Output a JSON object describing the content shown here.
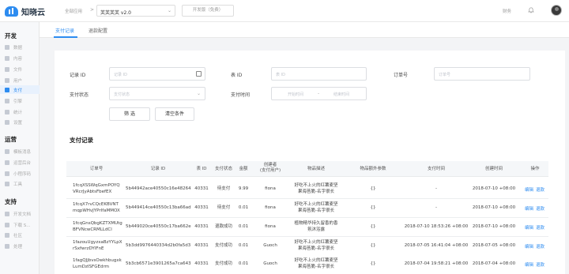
{
  "topbar": {
    "logo_text": "知晓云",
    "breadcrumb": "全部应用",
    "breadcrumb_sep": ">",
    "app_name": "芙芙芙芙 v2.0",
    "app_chevron": "⌄",
    "env_button": "开发版（免费）",
    "finance": "财务"
  },
  "sidebar": {
    "sections": [
      {
        "title": "开发",
        "items": [
          "数据",
          "内容",
          "文件",
          "用户",
          "支付",
          "引擎",
          "统计",
          "设置"
        ]
      },
      {
        "title": "运营",
        "items": [
          "模板消息",
          "运营后台",
          "小程序码",
          "工具"
        ]
      },
      {
        "title": "支持",
        "items": [
          "开发文档",
          "下载 S...",
          "社区",
          "处理"
        ]
      }
    ],
    "active_item": "支付"
  },
  "tabs": [
    "支付记录",
    "退款配置"
  ],
  "filters": {
    "record_id_label": "记录 ID",
    "record_id_placeholder": "记录 ID",
    "table_id_label": "表 ID",
    "table_id_placeholder": "表 ID",
    "order_no_label": "订单号",
    "order_no_placeholder": "订单号",
    "status_label": "支付状态",
    "status_placeholder": "支付状态",
    "time_label": "支付时间",
    "time_start": "开始时间",
    "time_sep": "-",
    "time_end": "结束时间",
    "filter_button": "筛 选",
    "clear_button": "清空条件"
  },
  "section_title": "支付记录",
  "table": {
    "headers": [
      "订单号",
      "记录 ID",
      "表 ID",
      "支付状态",
      "金额",
      "创建者\n(支付用户)",
      "物品描述",
      "物品额外参数",
      "支付时间",
      "创建时间",
      "操作"
    ],
    "rows": [
      {
        "order": [
          "1fcqXSSWqGxmPOYQ",
          "VRcrJyAbtsFbefEX"
        ],
        "record": "5b44942ace40550c16e48264",
        "table": "40331",
        "status": "待支付",
        "amount": "9.99",
        "creator": "fiona",
        "desc": [
          "好吃不上火的红薯麦坚",
          "果海苔脆-名字很长"
        ],
        "extra": "{}",
        "pay_time": "-",
        "create_time": "2018-07-10 +08:00",
        "ops": [
          "编辑",
          "退款"
        ]
      },
      {
        "order": [
          "1fcqX7rvCQcEKBVNT",
          "mqpWHvJYPrIfaMMOX"
        ],
        "record": "5b449414ce40550c13ba66ad",
        "table": "40331",
        "status": "待支付",
        "amount": "0.01",
        "creator": "fiona",
        "desc": [
          "好吃不上火的红薯麦坚",
          "果海苔脆-名字很长"
        ],
        "extra": "{}",
        "pay_time": "-",
        "create_time": "2018-07-10 +08:00",
        "ops": [
          "编辑",
          "退款"
        ]
      },
      {
        "order": [
          "1fcqGnsQbgKZTXMUtg",
          "BFVNcwCRMLLdCl"
        ],
        "record": "5b449020ce40550c17ba662e",
        "table": "40331",
        "status": "退款成功",
        "amount": "0.01",
        "creator": "fiona",
        "desc": [
          "植物精华持久留香的香",
          "氛沐浴露"
        ],
        "extra": "{}",
        "pay_time": "2018-07-10 18:53:26 +08:00",
        "create_time": "2018-07-10 +08:00",
        "ops": [
          "编辑",
          "退款"
        ]
      },
      {
        "order": [
          "1fazouUgyzxaBzYYLpX",
          "rSxfwrzDYIFnE"
        ],
        "record": "5b3dd9976440334d2b0fa5d3",
        "table": "40331",
        "status": "支付成功",
        "amount": "0.01",
        "creator": "Guoch",
        "desc": [
          "好吃不上火的红薯麦坚",
          "果海苔脆-名字很长"
        ],
        "extra": "{}",
        "pay_time": "2018-07-05 16:41:04 +08:00",
        "create_time": "2018-07-05 +08:00",
        "ops": [
          "编辑",
          "退款"
        ]
      },
      {
        "order": [
          "1fagQJjbvsOwkhbugxk",
          "LumDzISFGEdrm"
        ],
        "record": "5b3cb6571e3901265a7ca643",
        "table": "40331",
        "status": "支付成功",
        "amount": "0.01",
        "creator": "Guoch",
        "desc": [
          "好吃不上火的红薯麦坚",
          "果海苔脆-名字很长"
        ],
        "extra": "{}",
        "pay_time": "2018-07-04 19:58:21 +08:00",
        "create_time": "2018-07-04 +08:00",
        "ops": [
          "编辑",
          "退款"
        ]
      }
    ]
  }
}
